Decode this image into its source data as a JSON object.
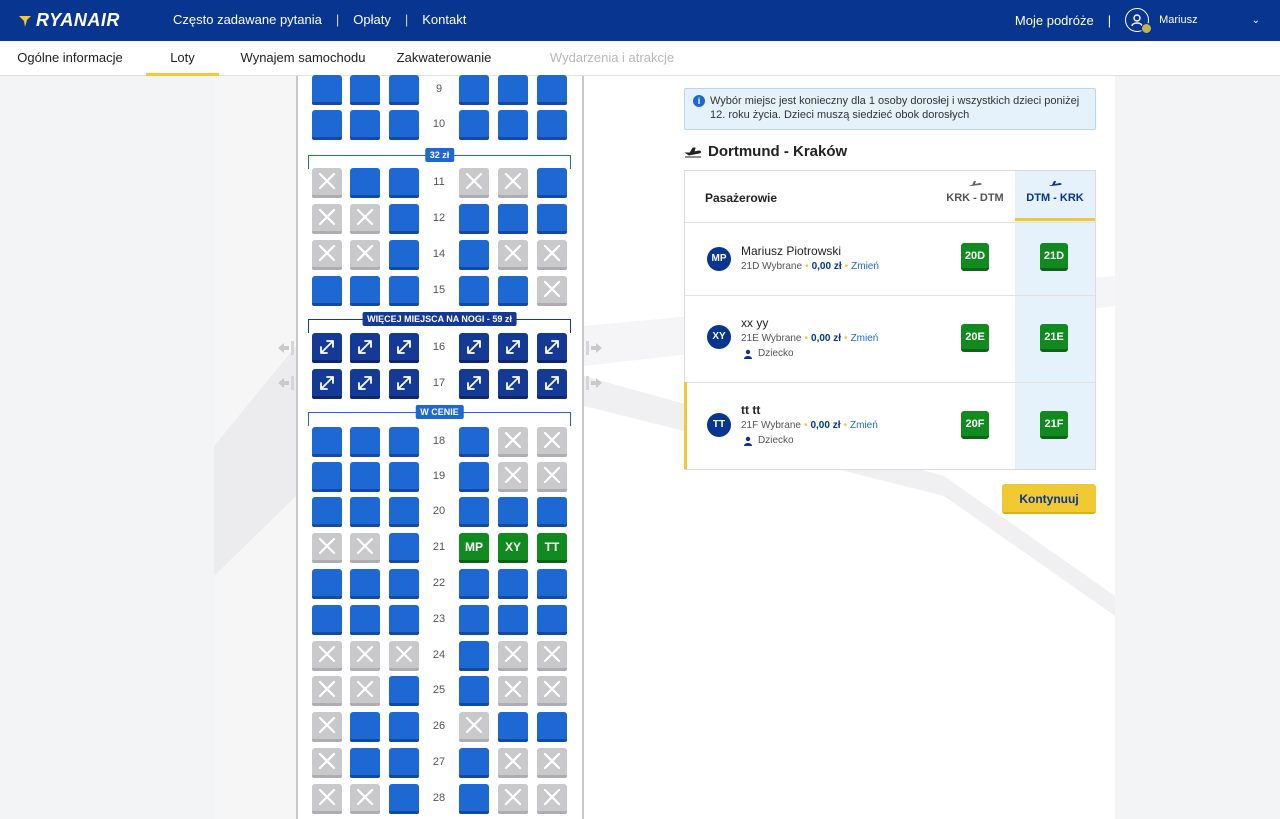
{
  "brand": {
    "name": "RYANAIR"
  },
  "topnav": {
    "links": [
      "Często zadawane pytania",
      "Opłaty",
      "Kontakt"
    ],
    "my_trips": "Moje podróże",
    "user_name": "Mariusz"
  },
  "tabs": [
    {
      "label": "Ogólne informacje",
      "state": "normal"
    },
    {
      "label": "Loty",
      "state": "active"
    },
    {
      "label": "Wynajem samochodu",
      "state": "normal"
    },
    {
      "label": "Zakwaterowanie",
      "state": "normal"
    },
    {
      "label": "Wydarzenia i atrakcje",
      "state": "disabled"
    }
  ],
  "seatmap": {
    "zones": {
      "standard": "32 zł",
      "extra_legroom": "WIĘCEJ MIEJSCA NA NOGI - 59 zł",
      "shade": "W CENIE"
    },
    "rows": [
      {
        "num": "9",
        "seats": [
          "s",
          "s",
          "s",
          "s",
          "s",
          "s"
        ]
      },
      {
        "num": "10",
        "seats": [
          "s",
          "s",
          "s",
          "s",
          "s",
          "s"
        ]
      },
      {
        "num": "11",
        "seats": [
          "x",
          "s",
          "s",
          "x",
          "x",
          "s"
        ]
      },
      {
        "num": "12",
        "seats": [
          "x",
          "x",
          "s",
          "s",
          "s",
          "s"
        ]
      },
      {
        "num": "14",
        "seats": [
          "x",
          "x",
          "s",
          "s",
          "x",
          "x"
        ]
      },
      {
        "num": "15",
        "seats": [
          "s",
          "s",
          "s",
          "s",
          "s",
          "x"
        ]
      },
      {
        "num": "16",
        "seats": [
          "l",
          "l",
          "l",
          "l",
          "l",
          "l"
        ]
      },
      {
        "num": "17",
        "seats": [
          "l",
          "l",
          "l",
          "l",
          "l",
          "l"
        ]
      },
      {
        "num": "18",
        "seats": [
          "s",
          "s",
          "s",
          "s",
          "x",
          "x"
        ]
      },
      {
        "num": "19",
        "seats": [
          "s",
          "s",
          "s",
          "s",
          "x",
          "x"
        ]
      },
      {
        "num": "20",
        "seats": [
          "s",
          "s",
          "s",
          "s",
          "s",
          "s"
        ]
      },
      {
        "num": "21",
        "seats": [
          "x",
          "x",
          "s",
          "MP",
          "XY",
          "TT"
        ]
      },
      {
        "num": "22",
        "seats": [
          "s",
          "s",
          "s",
          "s",
          "s",
          "s"
        ]
      },
      {
        "num": "23",
        "seats": [
          "s",
          "s",
          "s",
          "s",
          "s",
          "s"
        ]
      },
      {
        "num": "24",
        "seats": [
          "x",
          "x",
          "x",
          "s",
          "x",
          "x"
        ]
      },
      {
        "num": "25",
        "seats": [
          "x",
          "x",
          "s",
          "s",
          "x",
          "x"
        ]
      },
      {
        "num": "26",
        "seats": [
          "x",
          "s",
          "s",
          "x",
          "s",
          "s"
        ]
      },
      {
        "num": "27",
        "seats": [
          "x",
          "s",
          "s",
          "s",
          "x",
          "x"
        ]
      },
      {
        "num": "28",
        "seats": [
          "x",
          "x",
          "s",
          "s",
          "x",
          "x"
        ]
      }
    ]
  },
  "info_text": "Wybór miejsc jest konieczny dla 1 osoby dorosłej i wszystkich dzieci poniżej 12. roku życia. Dzieci muszą siedzieć obok dorosłych",
  "route_title": "Dortmund - Kraków",
  "passenger_table": {
    "header": "Pasażerowie",
    "outbound_label": "KRK - DTM",
    "return_label": "DTM - KRK",
    "passengers": [
      {
        "initials": "MP",
        "name": "Mariusz Piotrowski",
        "bold": false,
        "selected_text": "21D Wybrane",
        "price": "0,00 zł",
        "change": "Zmień",
        "child": "",
        "outbound_seat": "20D",
        "return_seat": "21D"
      },
      {
        "initials": "XY",
        "name": "xx yy",
        "bold": false,
        "selected_text": "21E Wybrane",
        "price": "0,00 zł",
        "change": "Zmień",
        "child": "Dziecko",
        "outbound_seat": "20E",
        "return_seat": "21E"
      },
      {
        "initials": "TT",
        "name": "tt tt",
        "bold": true,
        "selected_text": "21F Wybrane",
        "price": "0,00 zł",
        "change": "Zmień",
        "child": "Dziecko",
        "outbound_seat": "20F",
        "return_seat": "21F"
      }
    ]
  },
  "continue_label": "Kontynuuj",
  "colors": {
    "brand_blue": "#073590",
    "seat_blue": "#1d68d2",
    "legroom_blue": "#143a96",
    "selected_green": "#118a1f",
    "accent_yellow": "#f1c933"
  }
}
